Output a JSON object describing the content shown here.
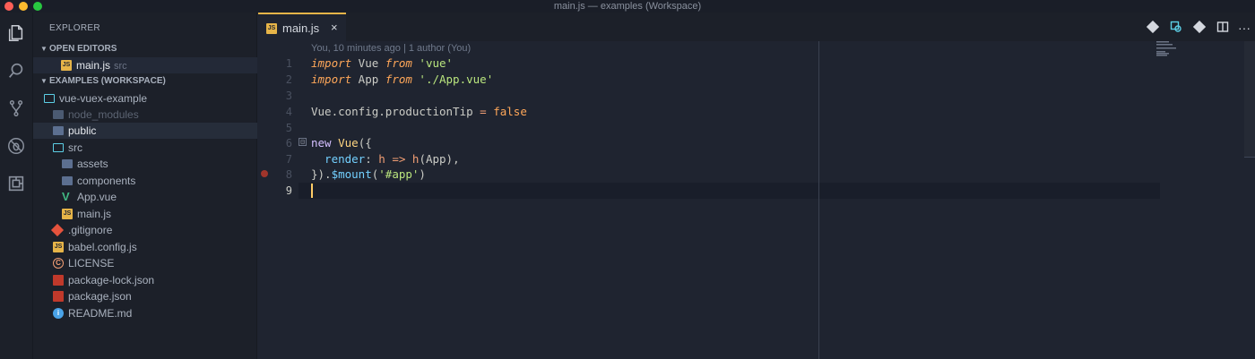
{
  "window": {
    "title": "main.js — examples (Workspace)"
  },
  "activity_bar": {
    "icons": [
      "files-icon",
      "search-icon",
      "source-control-icon",
      "debug-icon",
      "extensions-icon"
    ]
  },
  "sidebar": {
    "title": "EXPLORER",
    "open_editors": {
      "label": "OPEN EDITORS",
      "items": [
        {
          "name": "main.js",
          "sub": "src"
        }
      ]
    },
    "workspace": {
      "label": "EXAMPLES (WORKSPACE)",
      "items": [
        {
          "name": "vue-vuex-example"
        },
        {
          "name": "node_modules"
        },
        {
          "name": "public"
        },
        {
          "name": "src"
        },
        {
          "name": "assets"
        },
        {
          "name": "components"
        },
        {
          "name": "App.vue"
        },
        {
          "name": "main.js"
        },
        {
          "name": ".gitignore"
        },
        {
          "name": "babel.config.js"
        },
        {
          "name": "LICENSE"
        },
        {
          "name": "package-lock.json"
        },
        {
          "name": "package.json"
        },
        {
          "name": "README.md"
        }
      ]
    }
  },
  "editor": {
    "tab": {
      "name": "main.js",
      "close": "×"
    },
    "codelens": "You, 10 minutes ago | 1 author (You)",
    "line_numbers": [
      "1",
      "2",
      "3",
      "4",
      "5",
      "6",
      "7",
      "8",
      "9"
    ],
    "fold_marker": "⊟",
    "lines": [
      {
        "t1": "import",
        "t2": " Vue ",
        "t3": "from",
        "t4": " 'vue'"
      },
      {
        "t1": "import",
        "t2": " App ",
        "t3": "from",
        "t4": " './App.vue'"
      },
      {
        "text": ""
      },
      {
        "a": "Vue.config.productionTip ",
        "b": "=",
        "c": " false"
      },
      {
        "text": ""
      },
      {
        "a": "new",
        "b": " Vue",
        "c": "({"
      },
      {
        "a": "  render",
        "b": ": ",
        "c": "h",
        "d": " => ",
        "e": "h",
        "f": "(App),"
      },
      {
        "a": "}).",
        "b": "$mount",
        "c": "(",
        "d": "'#app'",
        "e": ")"
      },
      {
        "text": ""
      }
    ]
  },
  "toolbar": {
    "icons": [
      "git-compare-icon",
      "open-changes-icon",
      "git-branch-icon",
      "split-editor-icon",
      "more-actions-icon"
    ],
    "more": "···"
  },
  "colors": {
    "accent": "#e6b448",
    "background": "#1f2430",
    "cursor": "#ffcc66"
  }
}
